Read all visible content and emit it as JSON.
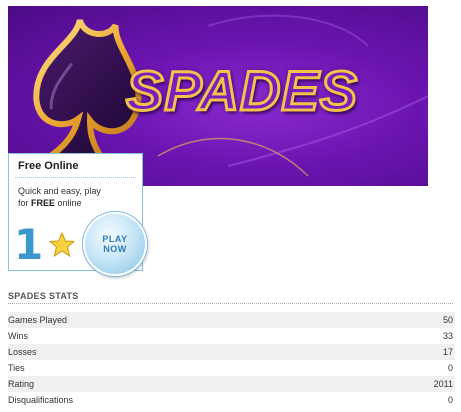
{
  "banner": {
    "title": "SPADES"
  },
  "promo": {
    "title": "Free Online",
    "desc_part1": "Quick and easy, play",
    "desc_part2": "for ",
    "desc_bold": "FREE",
    "desc_part3": " online",
    "number": "1",
    "play_line1": "PLAY",
    "play_line2": "NOW"
  },
  "stats": {
    "heading": "SPADES STATS",
    "rows": [
      {
        "label": "Games Played",
        "value": "50"
      },
      {
        "label": "Wins",
        "value": "33"
      },
      {
        "label": "Losses",
        "value": "17"
      },
      {
        "label": "Ties",
        "value": "0"
      },
      {
        "label": "Rating",
        "value": "2011"
      },
      {
        "label": "Disqualifications",
        "value": "0"
      }
    ]
  },
  "colors": {
    "banner_purple": "#6a14b0",
    "title_outline": "#f3c24a",
    "promo_blue": "#3a98cc"
  }
}
